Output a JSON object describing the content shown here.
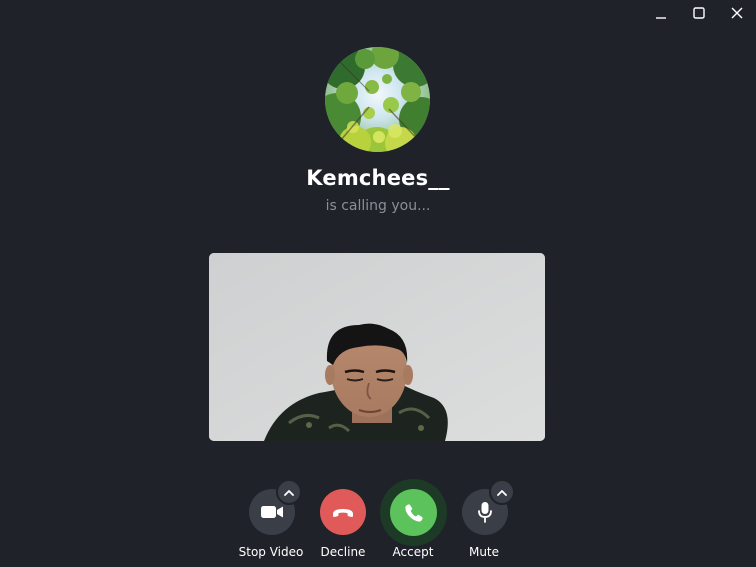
{
  "window": {
    "controls": {
      "minimize_icon": "minimize-icon",
      "maximize_icon": "maximize-icon",
      "close_icon": "close-icon"
    }
  },
  "call": {
    "caller_name": "Kemchees__",
    "status": "is calling you..."
  },
  "controls": {
    "stop_video": {
      "label": "Stop Video",
      "icon": "video-camera-icon",
      "color": "#3a3e47"
    },
    "decline": {
      "label": "Decline",
      "icon": "phone-hangup-icon",
      "color": "#e05a5a"
    },
    "accept": {
      "label": "Accept",
      "icon": "phone-icon",
      "color": "#5cc25c",
      "ring_color": "#1d3a26"
    },
    "mute": {
      "label": "Mute",
      "icon": "microphone-icon",
      "color": "#3a3e47"
    }
  },
  "theme": {
    "background": "#1f2229",
    "muted_text": "#8b8f97"
  }
}
